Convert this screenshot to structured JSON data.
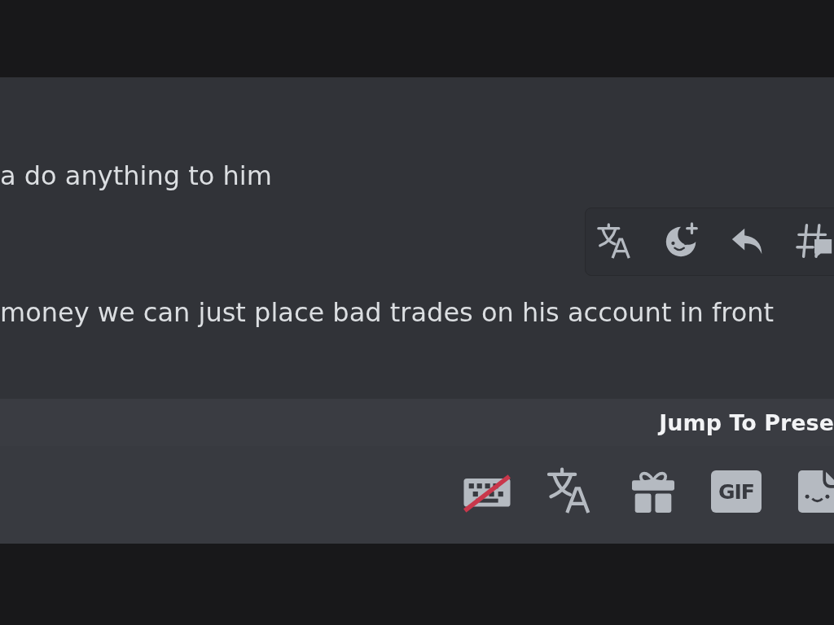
{
  "messages": [
    {
      "text": "a do anything to him"
    },
    {
      "text": "money we can just place bad trades on his account in front"
    }
  ],
  "message_toolbar": {
    "buttons": [
      {
        "kind": "translate"
      },
      {
        "kind": "emoji"
      },
      {
        "kind": "reply"
      },
      {
        "kind": "thread"
      }
    ]
  },
  "jump_bar": {
    "label": "Jump To Prese"
  },
  "composer": {
    "buttons": [
      {
        "kind": "keyboard"
      },
      {
        "kind": "translate"
      },
      {
        "kind": "gift"
      },
      {
        "kind": "gif",
        "label": "GIF"
      },
      {
        "kind": "sticker"
      }
    ]
  }
}
